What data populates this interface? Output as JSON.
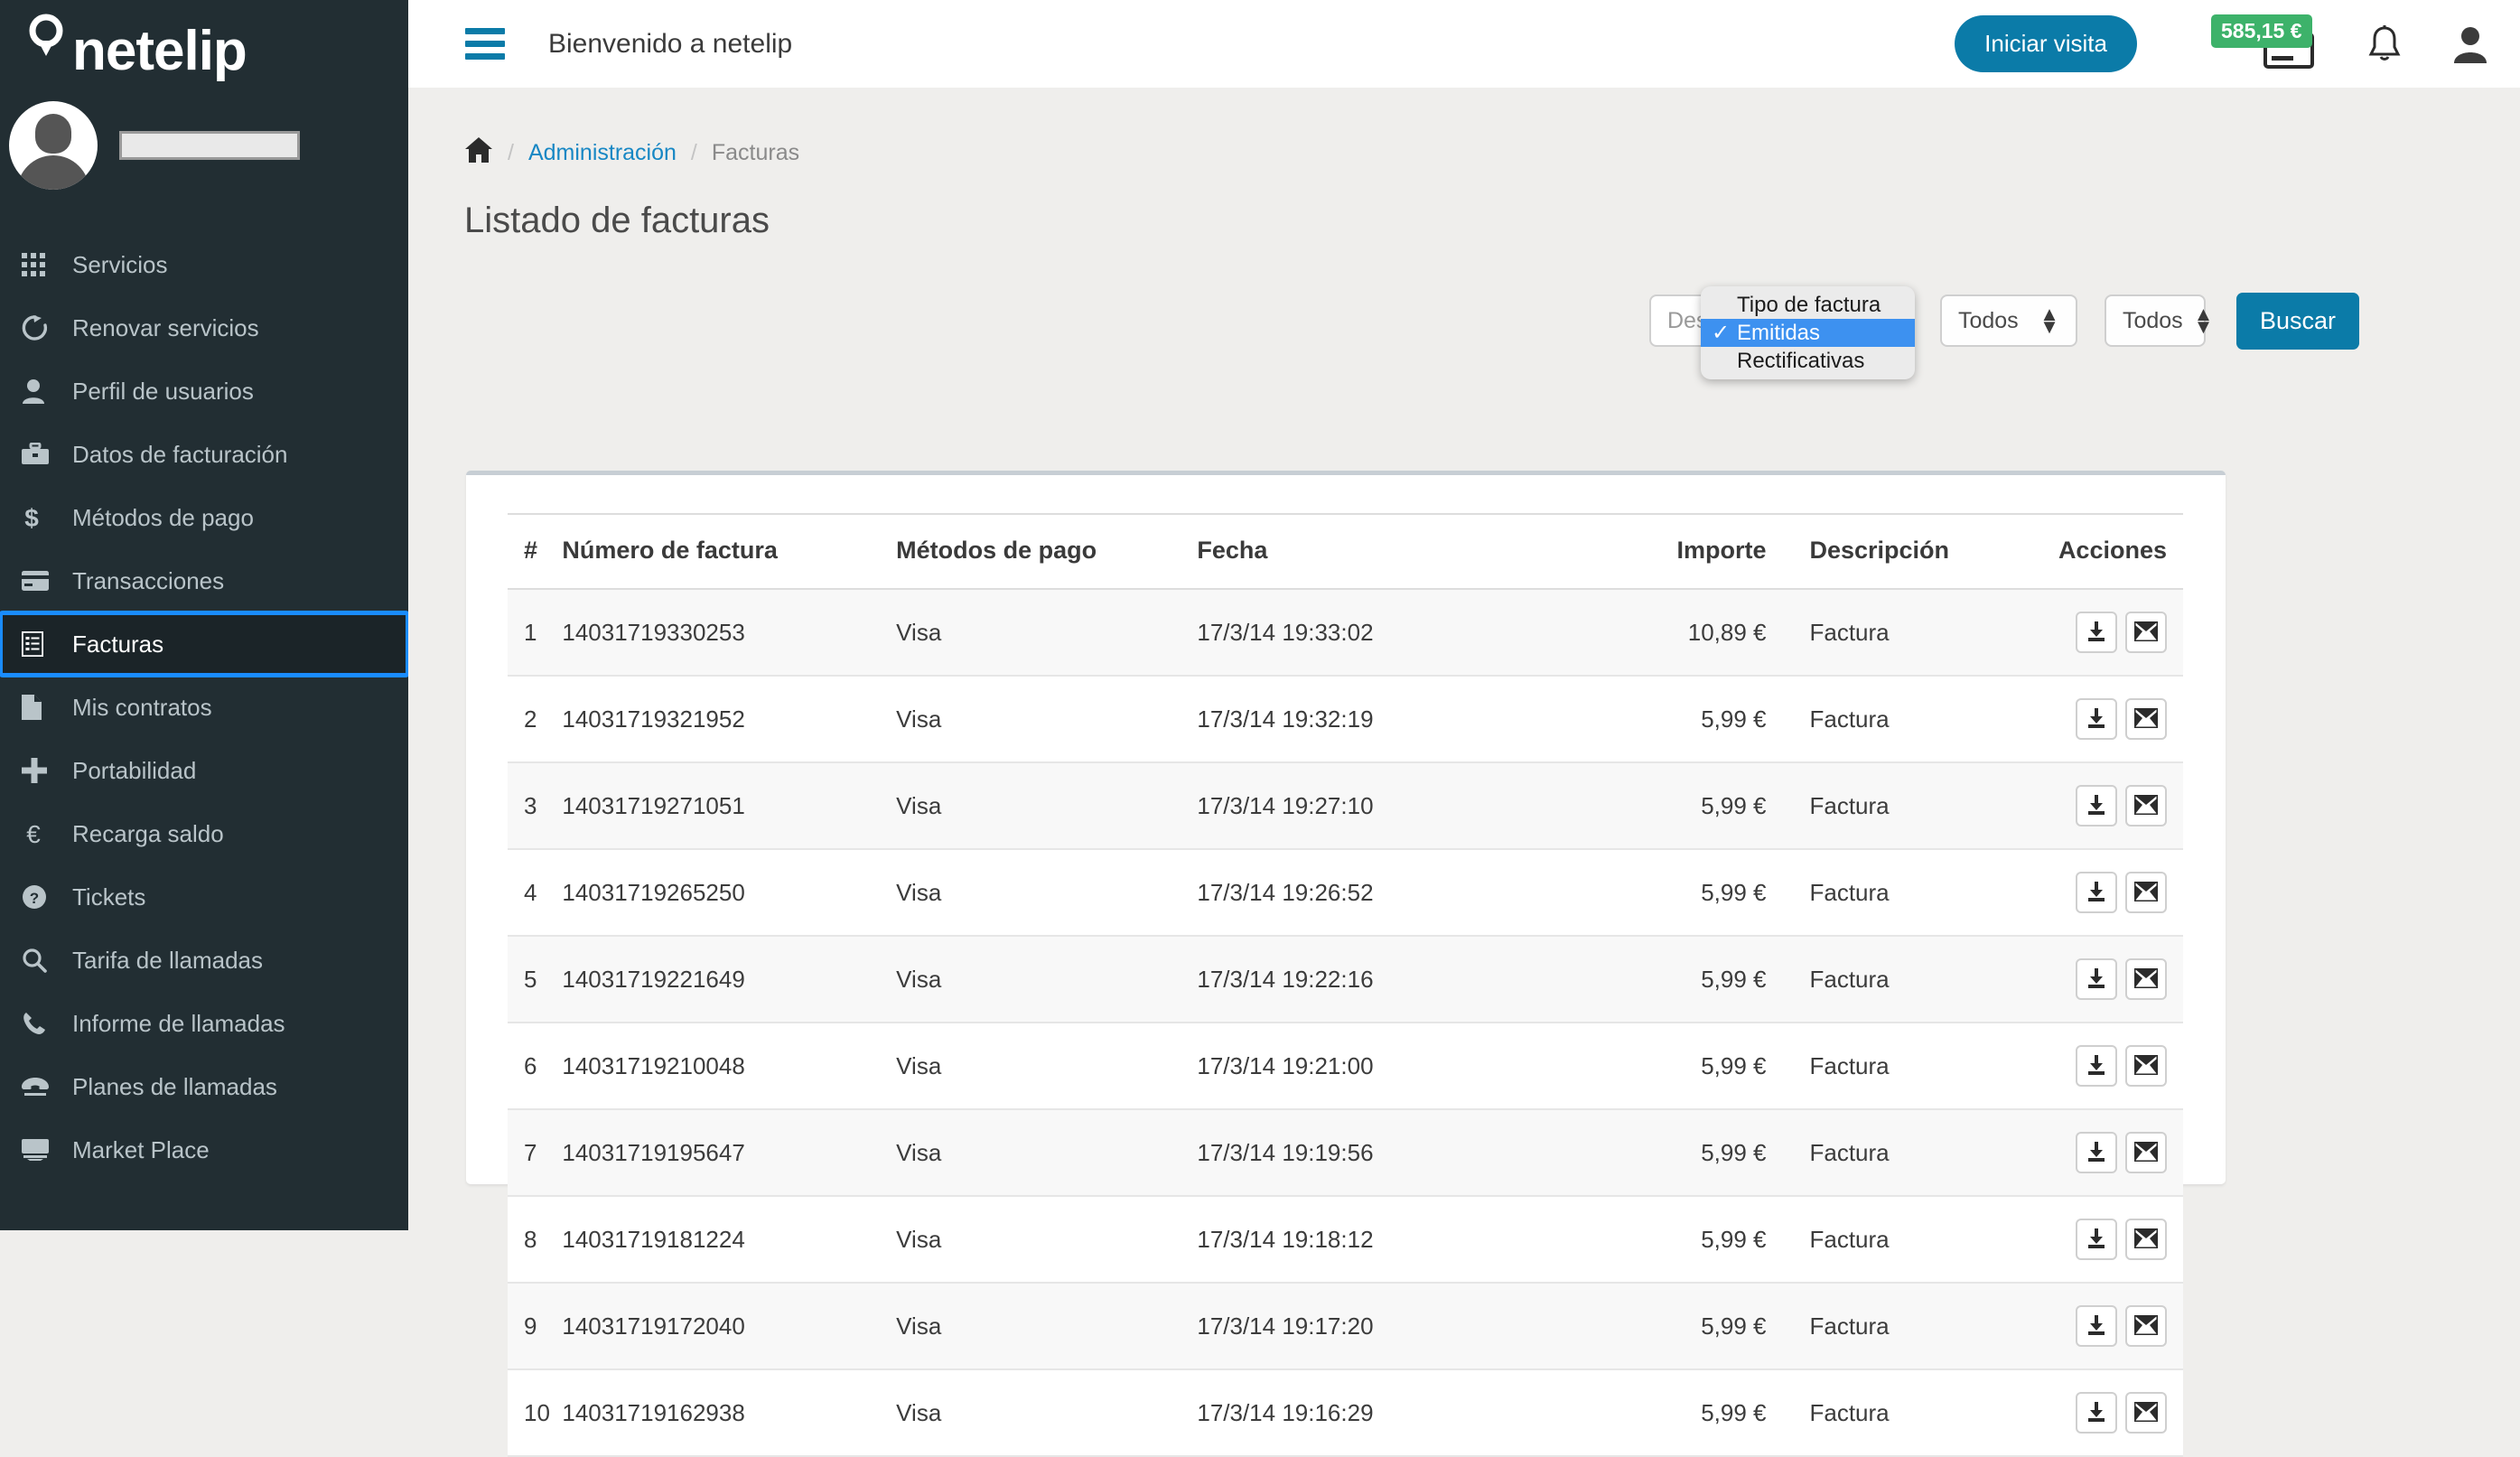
{
  "brand": {
    "name": "netelip",
    "pin_icon": "location-pin-icon"
  },
  "sidebar": {
    "user_name": "",
    "items": [
      {
        "label": "Servicios",
        "icon": "grid-icon",
        "active": false
      },
      {
        "label": "Renovar servicios",
        "icon": "refresh-icon",
        "active": false
      },
      {
        "label": "Perfil de usuarios",
        "icon": "user-icon",
        "active": false
      },
      {
        "label": "Datos de facturación",
        "icon": "briefcase-icon",
        "active": false
      },
      {
        "label": "Métodos de pago",
        "icon": "dollar-icon",
        "active": false
      },
      {
        "label": "Transacciones",
        "icon": "credit-card-icon",
        "active": false
      },
      {
        "label": "Facturas",
        "icon": "invoice-list-icon",
        "active": true
      },
      {
        "label": "Mis contratos",
        "icon": "file-icon",
        "active": false
      },
      {
        "label": "Portabilidad",
        "icon": "plus-icon",
        "active": false
      },
      {
        "label": "Recarga saldo",
        "icon": "euro-icon",
        "active": false
      },
      {
        "label": "Tickets",
        "icon": "question-circle-icon",
        "active": false
      },
      {
        "label": "Tarifa de llamadas",
        "icon": "search-icon",
        "active": false
      },
      {
        "label": "Informe de llamadas",
        "icon": "phone-icon",
        "active": false
      },
      {
        "label": "Planes de llamadas",
        "icon": "telephone-icon",
        "active": false
      },
      {
        "label": "Market Place",
        "icon": "desktop-icon",
        "active": false
      }
    ]
  },
  "topbar": {
    "menu_toggle_icon": "hamburger-icon",
    "welcome": "Bienvenido a netelip",
    "visit_button": "Iniciar visita",
    "balance": "585,15 €",
    "balance_icon": "credit-card-icon",
    "notifications_icon": "bell-icon",
    "account_icon": "user-account-icon"
  },
  "breadcrumb": {
    "home_icon": "home-icon",
    "separator": "/",
    "parent": "Administración",
    "current": "Facturas"
  },
  "page": {
    "title": "Listado de facturas"
  },
  "filters": {
    "tipo_factura": {
      "open": true,
      "selected": "Emitidas",
      "check_icon": "checkmark-icon",
      "options": [
        "Tipo de factura",
        "Emitidas",
        "Rectificativas"
      ]
    },
    "descripcion_placeholder": "Descripción",
    "descripcion_value": "",
    "estado_selected": "Todos",
    "anio_selected": "Todos",
    "search_button": "Buscar"
  },
  "table": {
    "columns": [
      "#",
      "Número de factura",
      "Métodos de pago",
      "Fecha",
      "Importe",
      "Descripción",
      "Acciones"
    ],
    "download_icon": "download-icon",
    "mail_icon": "envelope-icon",
    "rows": [
      {
        "n": "1",
        "invoice": "14031719330253",
        "method": "Visa",
        "date": "17/3/14 19:33:02",
        "amount": "10,89 €",
        "desc": "Factura"
      },
      {
        "n": "2",
        "invoice": "14031719321952",
        "method": "Visa",
        "date": "17/3/14 19:32:19",
        "amount": "5,99 €",
        "desc": "Factura"
      },
      {
        "n": "3",
        "invoice": "14031719271051",
        "method": "Visa",
        "date": "17/3/14 19:27:10",
        "amount": "5,99 €",
        "desc": "Factura"
      },
      {
        "n": "4",
        "invoice": "14031719265250",
        "method": "Visa",
        "date": "17/3/14 19:26:52",
        "amount": "5,99 €",
        "desc": "Factura"
      },
      {
        "n": "5",
        "invoice": "14031719221649",
        "method": "Visa",
        "date": "17/3/14 19:22:16",
        "amount": "5,99 €",
        "desc": "Factura"
      },
      {
        "n": "6",
        "invoice": "14031719210048",
        "method": "Visa",
        "date": "17/3/14 19:21:00",
        "amount": "5,99 €",
        "desc": "Factura"
      },
      {
        "n": "7",
        "invoice": "14031719195647",
        "method": "Visa",
        "date": "17/3/14 19:19:56",
        "amount": "5,99 €",
        "desc": "Factura"
      },
      {
        "n": "8",
        "invoice": "14031719181224",
        "method": "Visa",
        "date": "17/3/14 19:18:12",
        "amount": "5,99 €",
        "desc": "Factura"
      },
      {
        "n": "9",
        "invoice": "14031719172040",
        "method": "Visa",
        "date": "17/3/14 19:17:20",
        "amount": "5,99 €",
        "desc": "Factura"
      },
      {
        "n": "10",
        "invoice": "14031719162938",
        "method": "Visa",
        "date": "17/3/14 19:16:29",
        "amount": "5,99 €",
        "desc": "Factura"
      }
    ]
  },
  "colors": {
    "sidebar_bg": "#222e33",
    "accent_blue": "#0b7ba8",
    "link_blue": "#1787c4",
    "balance_green": "#3db26a",
    "focus_blue": "#1a8cff",
    "popup_highlight": "#3d91f0"
  }
}
